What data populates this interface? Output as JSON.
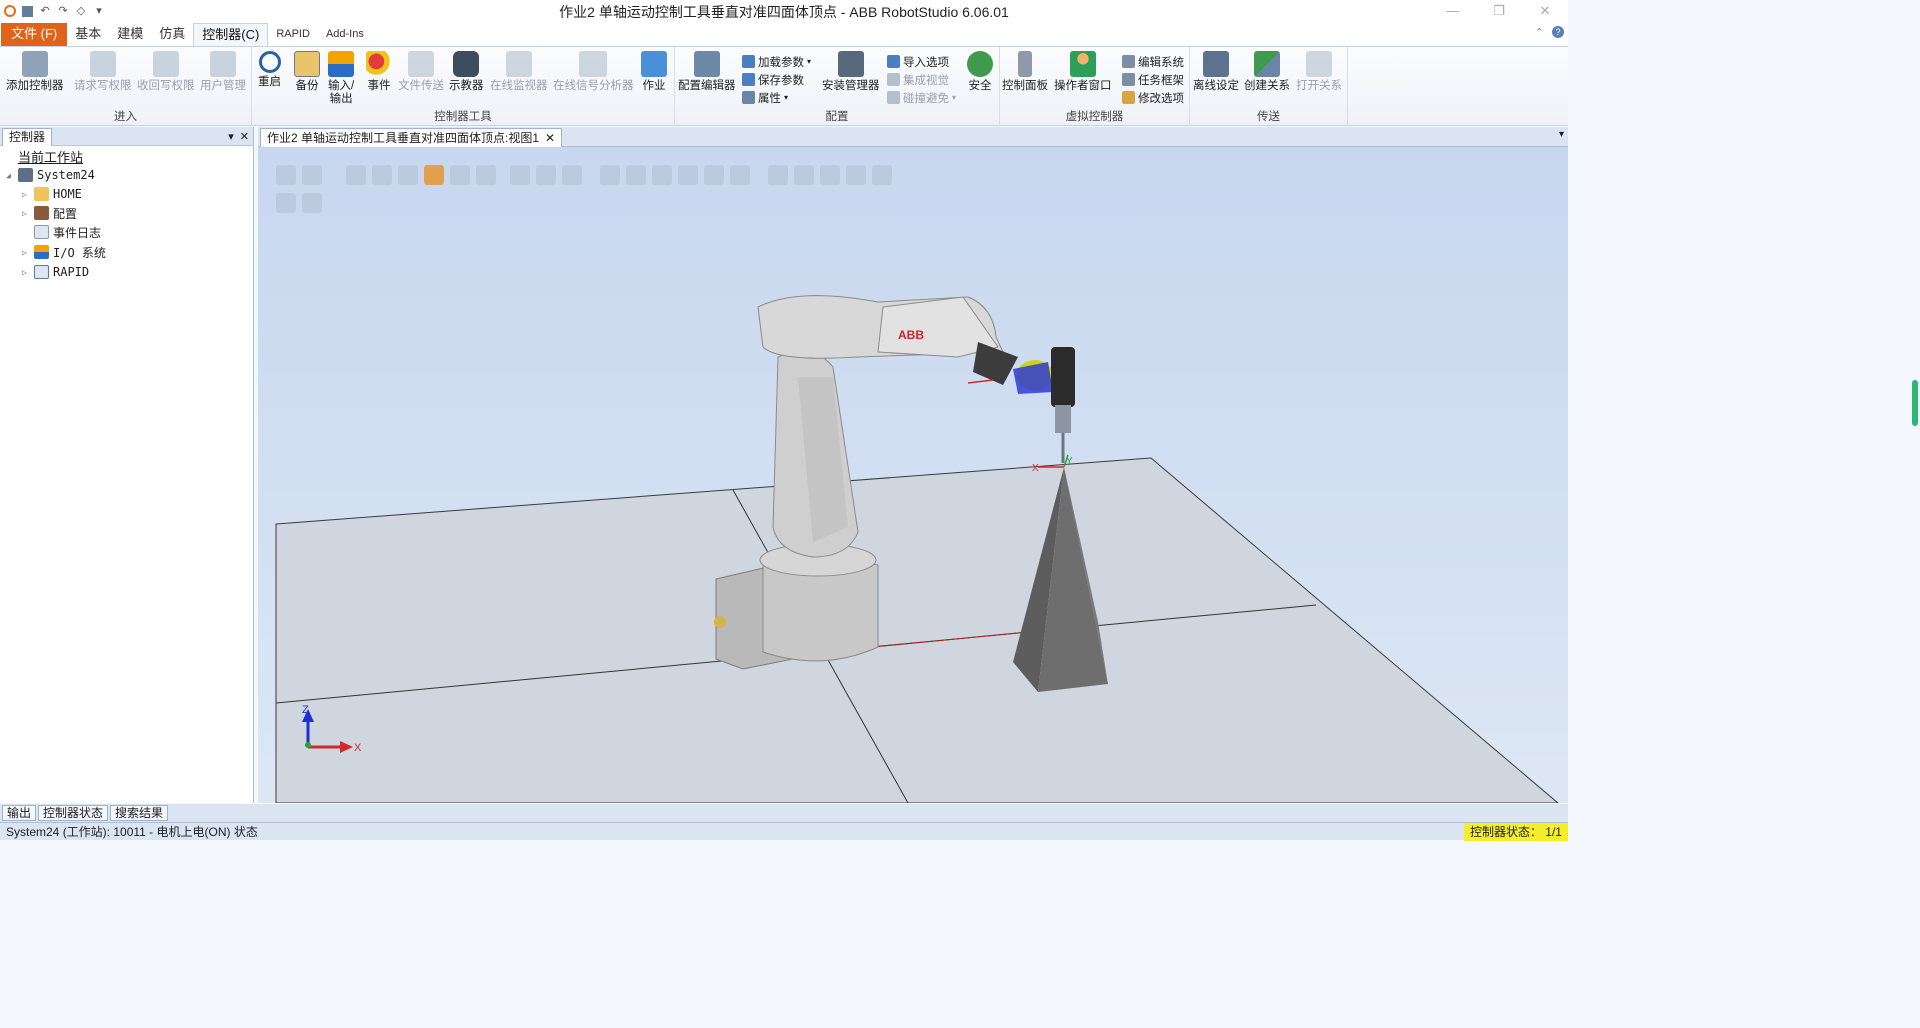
{
  "title": "作业2 单轴运动控制工具垂直对准四面体顶点 - ABB RobotStudio 6.06.01",
  "tabs": [
    "文件 (F)",
    "基本",
    "建模",
    "仿真",
    "控制器(C)",
    "RAPID",
    "Add-Ins"
  ],
  "ribbon": {
    "groups": [
      {
        "label": "进入",
        "items": [
          "添加控制器",
          "请求写权限",
          "收回写权限",
          "用户管理"
        ]
      },
      {
        "label": "控制器工具",
        "items": [
          "重启",
          "备份",
          "输入/\n输出",
          "事件",
          "文件传送",
          "示教器",
          "在线监视器",
          "在线信号分析器",
          "作业"
        ]
      },
      {
        "label": "配置",
        "items": [
          "配置编辑器",
          "加载参数",
          "保存参数",
          "属性",
          "安装管理器",
          "导入选项",
          "集成视觉",
          "碰撞避免",
          "安全"
        ]
      },
      {
        "label": "虚拟控制器",
        "items": [
          "控制面板",
          "操作者窗口",
          "编辑系统",
          "任务框架",
          "修改选项"
        ]
      },
      {
        "label": "传送",
        "items": [
          "离线设定",
          "创建关系",
          "打开关系"
        ]
      }
    ]
  },
  "left_panel": {
    "tab": "控制器",
    "tree": [
      "当前工作站",
      "System24",
      "HOME",
      "配置",
      "事件日志",
      "I/O 系统",
      "RAPID"
    ]
  },
  "view_tab": "作业2 单轴运动控制工具垂直对准四面体顶点:视图1",
  "viewport": {
    "brand": "ABB",
    "axis_labels": [
      "Z",
      "X"
    ],
    "tool_labels": [
      "X",
      "Y"
    ]
  },
  "bottom_tabs": [
    "输出",
    "控制器状态",
    "搜索结果"
  ],
  "status": {
    "text": "System24 (工作站): 10011 - 电机上电(ON) 状态",
    "controller_state": "控制器状态： 1/1"
  }
}
